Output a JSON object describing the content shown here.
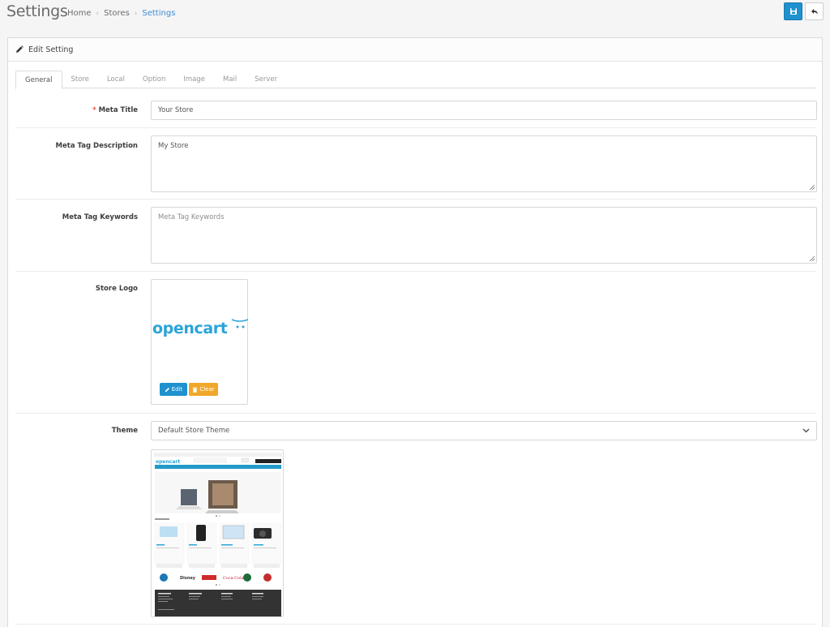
{
  "header": {
    "title": "Settings",
    "breadcrumb": [
      "Home",
      "Stores",
      "Settings"
    ],
    "save_icon": "save-icon",
    "back_icon": "reply-icon"
  },
  "panel": {
    "heading": "Edit Setting",
    "heading_icon": "pencil-icon"
  },
  "tabs": [
    "General",
    "Store",
    "Local",
    "Option",
    "Image",
    "Mail",
    "Server"
  ],
  "form": {
    "meta_title_label": "Meta Title",
    "meta_title_value": "Your Store",
    "meta_description_label": "Meta Tag Description",
    "meta_description_value": "My Store",
    "meta_keywords_label": "Meta Tag Keywords",
    "meta_keywords_placeholder": "Meta Tag Keywords",
    "store_logo_label": "Store Logo",
    "logo_text": "opencart",
    "edit_button": "Edit",
    "clear_button": "Clear",
    "theme_label": "Theme",
    "theme_value": "Default Store Theme"
  },
  "colors": {
    "primary": "#1e91cf",
    "warning": "#f0a72a",
    "required": "#e3503e",
    "logo": "#2aa4d9"
  }
}
